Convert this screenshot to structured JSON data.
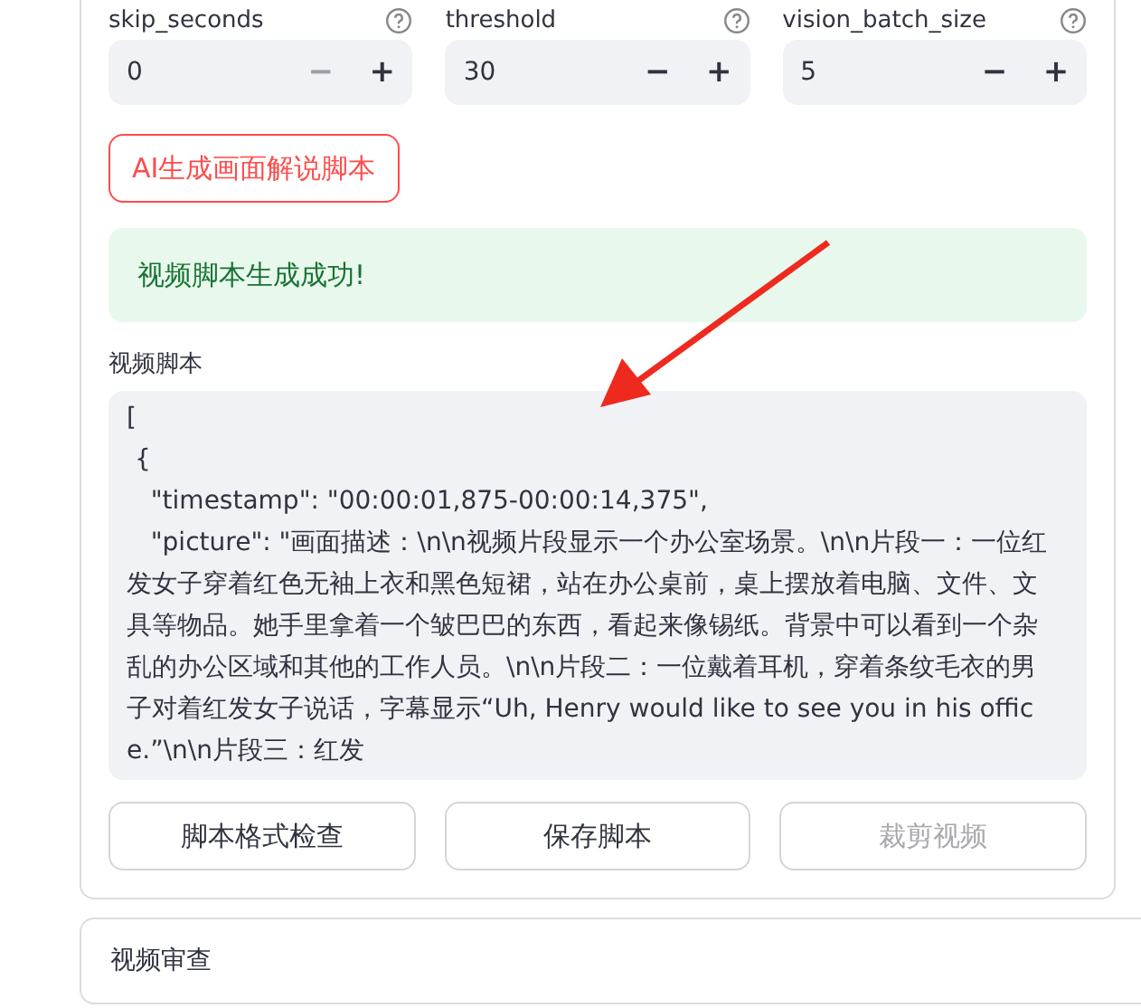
{
  "number_inputs": [
    {
      "label": "skip_seconds",
      "value": "0",
      "minus_disabled": true,
      "plus_disabled": false,
      "minus": "−",
      "plus": "+"
    },
    {
      "label": "threshold",
      "value": "30",
      "minus_disabled": false,
      "plus_disabled": false,
      "minus": "−",
      "plus": "+"
    },
    {
      "label": "vision_batch_size",
      "value": "5",
      "minus_disabled": false,
      "plus_disabled": false,
      "minus": "−",
      "plus": "+"
    }
  ],
  "generate_button": "AI生成画面解说脚本",
  "success_message": "视频脚本生成成功!",
  "script_label": "视频脚本",
  "script_text": "[\n {\n   \"timestamp\": \"00:00:01,875-00:00:14,375\",\n   \"picture\": \"画面描述：\\n\\n视频片段显示一个办公室场景。\\n\\n片段一：一位红发女子穿着红色无袖上衣和黑色短裙，站在办公桌前，桌上摆放着电脑、文件、文具等物品。她手里拿着一个皱巴巴的东西，看起来像锡纸。背景中可以看到一个杂乱的办公区域和其他的工作人员。\\n\\n片段二：一位戴着耳机，穿着条纹毛衣的男子对着红发女子说话，字幕显示“Uh, Henry would like to see you in his office.”\\n\\n片段三：红发",
  "action_buttons": [
    {
      "label": "脚本格式检查",
      "disabled": false
    },
    {
      "label": "保存脚本",
      "disabled": false
    },
    {
      "label": "裁剪视频",
      "disabled": true
    }
  ],
  "review_section": {
    "title": "视频审查"
  }
}
